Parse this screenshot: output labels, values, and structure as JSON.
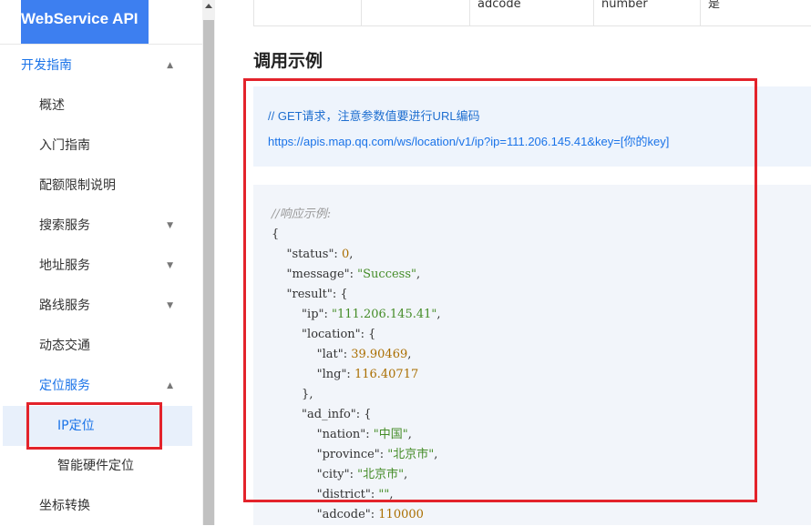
{
  "logo": "WebService API",
  "nav": {
    "group_dev": "开发指南",
    "overview": "概述",
    "getting_started": "入门指南",
    "quota": "配额限制说明",
    "search": "搜索服务",
    "address": "地址服务",
    "route": "路线服务",
    "traffic": "动态交通",
    "location": "定位服务",
    "ip_location": "IP定位",
    "hardware_location": "智能硬件定位",
    "coord_convert": "坐标转换"
  },
  "table": {
    "cells": [
      "",
      "",
      "adcode",
      "number",
      "是"
    ]
  },
  "section_title": "调用示例",
  "request": {
    "comment": "// GET请求，注意参数值要进行URL编码",
    "url": "https://apis.map.qq.com/ws/location/v1/ip?ip=111.206.145.41&key=[你的key]"
  },
  "response": {
    "comment": "//响应示例:",
    "status_key": "status",
    "status_val": "0",
    "message_key": "message",
    "message_val": "Success",
    "result_key": "result",
    "ip_key": "ip",
    "ip_val": "111.206.145.41",
    "location_key": "location",
    "lat_key": "lat",
    "lat_val": "39.90469",
    "lng_key": "lng",
    "lng_val": "116.40717",
    "ad_info_key": "ad_info",
    "nation_key": "nation",
    "nation_val": "中国",
    "province_key": "province",
    "province_val": "北京市",
    "city_key": "city",
    "city_val": "北京市",
    "district_key": "district",
    "district_val": "",
    "adcode_key": "adcode",
    "adcode_val": "110000"
  },
  "colors": {
    "accent": "#1a73e8",
    "logo_bg": "#3d7ff0",
    "highlight": "#e3232b"
  }
}
